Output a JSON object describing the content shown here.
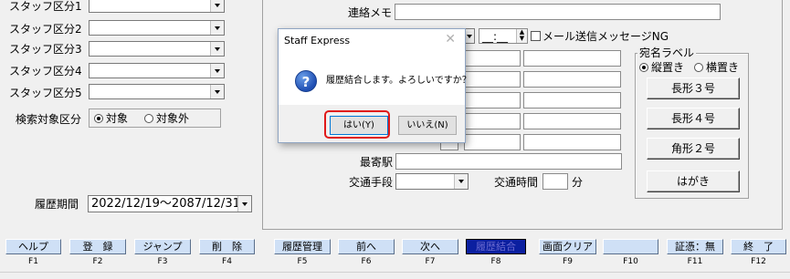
{
  "left_panel": {
    "staff_categories": [
      {
        "label": "スタッフ区分1",
        "value": ""
      },
      {
        "label": "スタッフ区分2",
        "value": ""
      },
      {
        "label": "スタッフ区分3",
        "value": ""
      },
      {
        "label": "スタッフ区分4",
        "value": ""
      },
      {
        "label": "スタッフ区分5",
        "value": ""
      }
    ],
    "search_target": {
      "label": "検索対象区分",
      "options": [
        "対象",
        "対象外"
      ],
      "selected": "対象"
    },
    "history_period": {
      "label": "履歴期間",
      "value": "2022/12/19～2087/12/31"
    }
  },
  "right_panel": {
    "contact_memo_label": "連絡メモ",
    "contact_memo_value": "",
    "time_value": "__:__",
    "mail_ng_label": "メール送信メッセージNG",
    "address_label_group": {
      "title": "宛名ラベル",
      "orientation_options": [
        "縦置き",
        "横置き"
      ],
      "orientation_selected": "縦置き",
      "buttons": [
        "長形３号",
        "長形４号",
        "角形２号",
        "はがき"
      ]
    },
    "nearest_station_label": "最寄駅",
    "nearest_station_value": "",
    "transport_label": "交通手段",
    "transport_value": "",
    "commute_time_label": "交通時間",
    "commute_time_value": "",
    "commute_time_unit": "分"
  },
  "dialog": {
    "title": "Staff Express",
    "close_glyph": "✕",
    "icon": "question-icon",
    "message": "履歴結合します。よろしいですか？",
    "yes_label": "はい(Y)",
    "no_label": "いいえ(N)"
  },
  "function_keys": [
    {
      "key": "F1",
      "label": "ヘルプ"
    },
    {
      "key": "F2",
      "label": "登　録"
    },
    {
      "key": "F3",
      "label": "ジャンプ"
    },
    {
      "key": "F4",
      "label": "削　除"
    },
    {
      "key": "F5",
      "label": "履歴管理"
    },
    {
      "key": "F6",
      "label": "前へ"
    },
    {
      "key": "F7",
      "label": "次へ"
    },
    {
      "key": "F8",
      "label": "履歴結合",
      "active": true
    },
    {
      "key": "F9",
      "label": "画面クリア"
    },
    {
      "key": "F10",
      "label": ""
    },
    {
      "key": "F11",
      "label": "証憑：無"
    },
    {
      "key": "F12",
      "label": "終　了"
    }
  ],
  "colors": {
    "fkey_bg": "#cfe0f6",
    "fkey_active_bg": "#0b1fa0",
    "highlight_border": "#e01919",
    "dialog_border": "#8ea4c2"
  }
}
